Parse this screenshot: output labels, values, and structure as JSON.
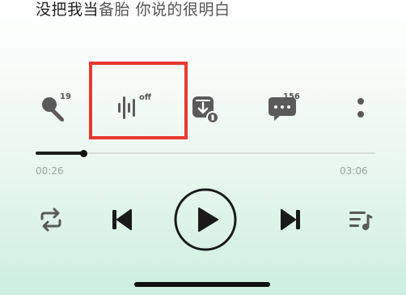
{
  "lyric": {
    "main": "没把我当",
    "dim": "备胎 你说的很明白"
  },
  "actions": {
    "karaoke_count": "19",
    "effect_status": "off",
    "comments_count": "156"
  },
  "progress": {
    "elapsed": "00:26",
    "total": "03:06",
    "fraction": 0.14
  },
  "icons": {
    "karaoke": "microphone-icon",
    "effect": "sound-wave-icon",
    "download": "download-icon",
    "comments": "comment-icon",
    "more": "more-vertical-icon",
    "repeat": "repeat-icon",
    "previous": "previous-track-icon",
    "play": "play-icon",
    "next": "next-track-icon",
    "playlist": "playlist-icon"
  },
  "colors": {
    "highlight": "#e8392f",
    "icon": "#555555",
    "text": "#1f1f1f"
  }
}
